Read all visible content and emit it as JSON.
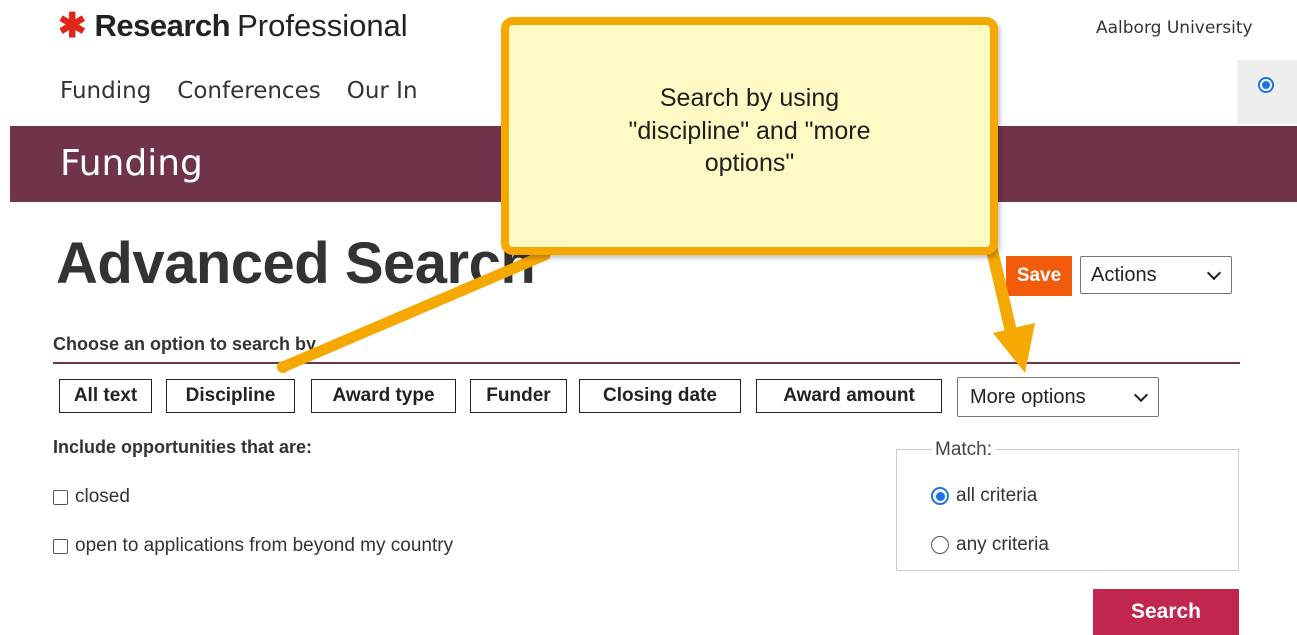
{
  "header": {
    "brand_strong": "Research",
    "brand_light": "Professional",
    "organization": "Aalborg University",
    "nav": [
      "Funding",
      "Conferences",
      "Our In"
    ]
  },
  "banner": {
    "title": "Funding"
  },
  "main": {
    "title": "Advanced Search",
    "save_label": "Save",
    "actions_selected": "Actions",
    "choose_label": "Choose an option to search by",
    "options": [
      "All text",
      "Discipline",
      "Award type",
      "Funder",
      "Closing date",
      "Award amount"
    ],
    "more_options_selected": "More options",
    "include_label": "Include opportunities that are:",
    "checkboxes": [
      "closed",
      "open to applications from beyond my country"
    ],
    "match": {
      "legend": "Match:",
      "options": [
        "all criteria",
        "any criteria"
      ],
      "selected": "all criteria"
    },
    "search_label": "Search"
  },
  "callout": {
    "text": "Search by using \"discipline\" and \"more options\""
  },
  "colors": {
    "banner": "#70344a",
    "save": "#f25a0c",
    "search": "#c1274e",
    "callout_border": "#f5a800",
    "callout_fill": "#fff9c4",
    "brand_asterisk": "#e1251b",
    "radio_accent": "#1a73e8"
  },
  "icons": [
    "asterisk-logo-icon",
    "chevron-down-icon",
    "arrow-icon"
  ]
}
